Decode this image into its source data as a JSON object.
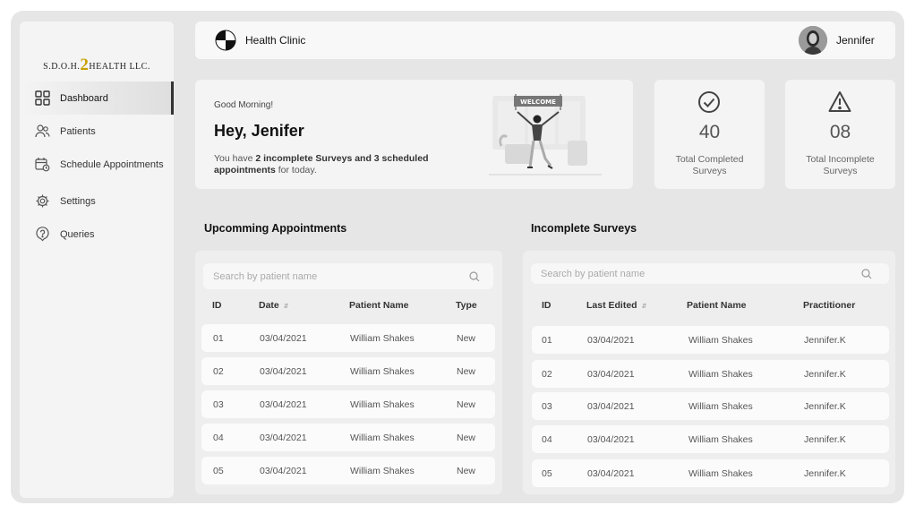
{
  "sidebar": {
    "logo": {
      "before": "S.D.O.H.",
      "two": "2",
      "after": "HEALTH LLC."
    },
    "items": [
      {
        "label": "Dashboard",
        "icon": "grid-icon"
      },
      {
        "label": "Patients",
        "icon": "users-icon"
      },
      {
        "label": "Schedule Appointments",
        "icon": "calendar-clock-icon"
      },
      {
        "label": "Settings",
        "icon": "gear-icon"
      },
      {
        "label": "Queries",
        "icon": "help-circle-icon"
      }
    ]
  },
  "topbar": {
    "brand": "Health Clinic",
    "user": "Jennifer"
  },
  "welcome": {
    "greeting": "Good Morning!",
    "title": "Hey, Jenifer",
    "msg_prefix": "You have ",
    "msg_bold": "2 incomplete Surveys and 3 scheduled appointments",
    "msg_suffix": " for today.",
    "banner": "WELCOME"
  },
  "stats": [
    {
      "value": "40",
      "label": "Total Completed Surveys",
      "icon": "check-circle-icon"
    },
    {
      "value": "08",
      "label": "Total Incomplete Surveys",
      "icon": "warning-icon"
    }
  ],
  "appointments": {
    "title": "Upcomming Appointments",
    "search_placeholder": "Search by patient name",
    "headers": [
      "ID",
      "Date",
      "Patient Name",
      "Type"
    ],
    "rows": [
      [
        "01",
        "03/04/2021",
        "William Shakes",
        "New"
      ],
      [
        "02",
        "03/04/2021",
        "William Shakes",
        "New"
      ],
      [
        "03",
        "03/04/2021",
        "William Shakes",
        "New"
      ],
      [
        "04",
        "03/04/2021",
        "William Shakes",
        "New"
      ],
      [
        "05",
        "03/04/2021",
        "William Shakes",
        "New"
      ]
    ]
  },
  "surveys": {
    "title": "Incomplete Surveys",
    "search_placeholder": "Search by patient name",
    "headers": [
      "ID",
      "Last Edited",
      "Patient Name",
      "Practitioner"
    ],
    "rows": [
      [
        "01",
        "03/04/2021",
        "William Shakes",
        "Jennifer.K"
      ],
      [
        "02",
        "03/04/2021",
        "William Shakes",
        "Jennifer.K"
      ],
      [
        "03",
        "03/04/2021",
        "William Shakes",
        "Jennifer.K"
      ],
      [
        "04",
        "03/04/2021",
        "William Shakes",
        "Jennifer.K"
      ],
      [
        "05",
        "03/04/2021",
        "William Shakes",
        "Jennifer.K"
      ]
    ]
  }
}
